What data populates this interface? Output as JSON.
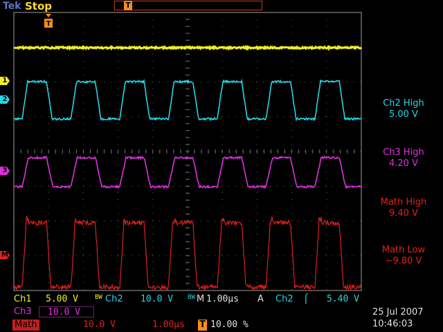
{
  "topbar": {
    "brand": "Tek",
    "run_state": "Stop",
    "trigger_position_label": "T"
  },
  "channel_markers": {
    "ch1": "1",
    "ch2": "2",
    "ch3": "3",
    "math": "M"
  },
  "measurements": [
    {
      "label": "Ch2 High",
      "value": "5.00 V",
      "color": "#22d8e8"
    },
    {
      "label": "Ch3 High",
      "value": "4.20 V",
      "color": "#e030e0"
    },
    {
      "label": "Math High",
      "value": "9.40 V",
      "color": "#e02020"
    },
    {
      "label": "Math Low",
      "value": "−9.80 V",
      "color": "#e02020"
    }
  ],
  "status": {
    "ch1_label": "Ch1",
    "ch1_scale": "5.00 V",
    "ch1_bw": "BW",
    "ch2_label": "Ch2",
    "ch2_scale": "10.0 V",
    "ch2_bw": "BW",
    "timebase_label": "M",
    "timebase": "1.00µs",
    "trigger_mode": "A",
    "trigger_source": "Ch2",
    "trigger_slope": "⌠",
    "trigger_level": "5.40 V",
    "ch3_label": "Ch3",
    "ch3_scale": "10.0 V",
    "math_label": "Math",
    "math_scale": "10.0 V",
    "math_time": "1.00µs",
    "trigger_pos_icon": "T",
    "trigger_position": "10.00 %",
    "date": "25 Jul  2007",
    "time": "10:46:03"
  },
  "colors": {
    "ch1": "#f0f020",
    "ch2": "#22d8e8",
    "ch3": "#e030e0",
    "math": "#e02020",
    "accent": "#ff8a1a"
  }
}
